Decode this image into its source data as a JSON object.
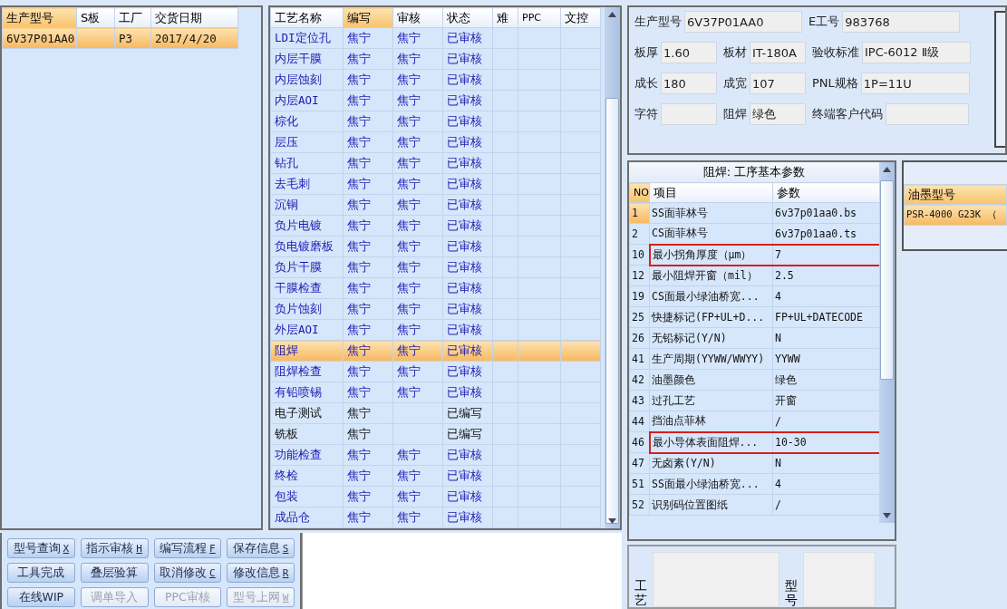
{
  "orders": {
    "columns": [
      {
        "label": "生产型号",
        "sorted": true
      },
      {
        "label": "S板",
        "sorted": false
      },
      {
        "label": "工厂",
        "sorted": false
      },
      {
        "label": "交货日期",
        "sorted": false
      }
    ],
    "rows": [
      {
        "cells": [
          "6V37P01AA0",
          "",
          "P3",
          "2017/4/20"
        ],
        "selected": true
      }
    ]
  },
  "process": {
    "columns": [
      {
        "label": "工艺名称",
        "sorted": false
      },
      {
        "label": "编写",
        "sorted": true
      },
      {
        "label": "审核",
        "sorted": false
      },
      {
        "label": "状态",
        "sorted": false
      },
      {
        "label": "难",
        "sorted": false
      },
      {
        "label": "PPC",
        "sorted": false
      },
      {
        "label": "文控",
        "sorted": false
      }
    ],
    "rows": [
      {
        "cells": [
          "LDI定位孔",
          "焦宁",
          "焦宁",
          "已审核",
          "",
          "",
          ""
        ],
        "reviewed": true,
        "selected": false
      },
      {
        "cells": [
          "内层干膜",
          "焦宁",
          "焦宁",
          "已审核",
          "",
          "",
          ""
        ],
        "reviewed": true,
        "selected": false
      },
      {
        "cells": [
          "内层蚀刻",
          "焦宁",
          "焦宁",
          "已审核",
          "",
          "",
          ""
        ],
        "reviewed": true,
        "selected": false
      },
      {
        "cells": [
          "内层AOI",
          "焦宁",
          "焦宁",
          "已审核",
          "",
          "",
          ""
        ],
        "reviewed": true,
        "selected": false
      },
      {
        "cells": [
          "棕化",
          "焦宁",
          "焦宁",
          "已审核",
          "",
          "",
          ""
        ],
        "reviewed": true,
        "selected": false
      },
      {
        "cells": [
          "层压",
          "焦宁",
          "焦宁",
          "已审核",
          "",
          "",
          ""
        ],
        "reviewed": true,
        "selected": false
      },
      {
        "cells": [
          "钻孔",
          "焦宁",
          "焦宁",
          "已审核",
          "",
          "",
          ""
        ],
        "reviewed": true,
        "selected": false
      },
      {
        "cells": [
          "去毛刺",
          "焦宁",
          "焦宁",
          "已审核",
          "",
          "",
          ""
        ],
        "reviewed": true,
        "selected": false
      },
      {
        "cells": [
          "沉铜",
          "焦宁",
          "焦宁",
          "已审核",
          "",
          "",
          ""
        ],
        "reviewed": true,
        "selected": false
      },
      {
        "cells": [
          "负片电镀",
          "焦宁",
          "焦宁",
          "已审核",
          "",
          "",
          ""
        ],
        "reviewed": true,
        "selected": false
      },
      {
        "cells": [
          "负电镀磨板",
          "焦宁",
          "焦宁",
          "已审核",
          "",
          "",
          ""
        ],
        "reviewed": true,
        "selected": false
      },
      {
        "cells": [
          "负片干膜",
          "焦宁",
          "焦宁",
          "已审核",
          "",
          "",
          ""
        ],
        "reviewed": true,
        "selected": false
      },
      {
        "cells": [
          "干膜检查",
          "焦宁",
          "焦宁",
          "已审核",
          "",
          "",
          ""
        ],
        "reviewed": true,
        "selected": false
      },
      {
        "cells": [
          "负片蚀刻",
          "焦宁",
          "焦宁",
          "已审核",
          "",
          "",
          ""
        ],
        "reviewed": true,
        "selected": false
      },
      {
        "cells": [
          "外层AOI",
          "焦宁",
          "焦宁",
          "已审核",
          "",
          "",
          ""
        ],
        "reviewed": true,
        "selected": false
      },
      {
        "cells": [
          "阻焊",
          "焦宁",
          "焦宁",
          "已审核",
          "",
          "",
          ""
        ],
        "reviewed": true,
        "selected": true
      },
      {
        "cells": [
          "阻焊检查",
          "焦宁",
          "焦宁",
          "已审核",
          "",
          "",
          ""
        ],
        "reviewed": true,
        "selected": false
      },
      {
        "cells": [
          "有铅喷锡",
          "焦宁",
          "焦宁",
          "已审核",
          "",
          "",
          ""
        ],
        "reviewed": true,
        "selected": false
      },
      {
        "cells": [
          "电子测试",
          "焦宁",
          "",
          "已编写",
          "",
          "",
          ""
        ],
        "reviewed": false,
        "selected": false
      },
      {
        "cells": [
          "铣板",
          "焦宁",
          "",
          "已编写",
          "",
          "",
          ""
        ],
        "reviewed": false,
        "selected": false
      },
      {
        "cells": [
          "功能检查",
          "焦宁",
          "焦宁",
          "已审核",
          "",
          "",
          ""
        ],
        "reviewed": true,
        "selected": false
      },
      {
        "cells": [
          "终检",
          "焦宁",
          "焦宁",
          "已审核",
          "",
          "",
          ""
        ],
        "reviewed": true,
        "selected": false
      },
      {
        "cells": [
          "包装",
          "焦宁",
          "焦宁",
          "已审核",
          "",
          "",
          ""
        ],
        "reviewed": true,
        "selected": false
      },
      {
        "cells": [
          "成品仓",
          "焦宁",
          "焦宁",
          "已审核",
          "",
          "",
          ""
        ],
        "reviewed": true,
        "selected": false
      }
    ]
  },
  "buttons": [
    {
      "label": "型号查询",
      "key": "X",
      "disabled": false
    },
    {
      "label": "指示审核",
      "key": "H",
      "disabled": false
    },
    {
      "label": "编写流程",
      "key": "F",
      "disabled": false
    },
    {
      "label": "保存信息",
      "key": "S",
      "disabled": false
    },
    {
      "label": "工具完成",
      "disabled": false
    },
    {
      "label": "叠层验算",
      "disabled": false
    },
    {
      "label": "取消修改",
      "key": "C",
      "disabled": false
    },
    {
      "label": "修改信息",
      "key": "R",
      "disabled": false
    },
    {
      "label": "在线WIP",
      "disabled": false
    },
    {
      "label": "调单导入",
      "disabled": true
    },
    {
      "label": "PPC审核",
      "disabled": true
    },
    {
      "label": "型号上网",
      "key": "W",
      "disabled": true
    }
  ],
  "info_fields": [
    [
      {
        "label": "生产型号",
        "value": "6V37P01AA0"
      },
      {
        "label": "E工号",
        "value": "983768"
      }
    ],
    [
      {
        "label": "板厚",
        "value": "1.60"
      },
      {
        "label": "板材",
        "value": "IT-180A"
      },
      {
        "label": "验收标准",
        "value": "IPC-6012 Ⅱ级"
      }
    ],
    [
      {
        "label": "成长",
        "value": "180"
      },
      {
        "label": "成宽",
        "value": "107"
      },
      {
        "label": "PNL规格",
        "value": "1P=11U"
      }
    ],
    [
      {
        "label": "字符"
      },
      {
        "label": "阻焊",
        "value": "绿色"
      },
      {
        "label": "终端客户代码"
      }
    ]
  ],
  "params": {
    "title": "阻焊: 工序基本参数",
    "columns": [
      {
        "label": "NO",
        "sorted": true
      },
      {
        "label": "项目",
        "sorted": false
      },
      {
        "label": "参数",
        "sorted": false
      }
    ],
    "rows": [
      {
        "no": "1",
        "item": "SS面菲林号",
        "value": "6v37p01aa0.bs",
        "selected": true,
        "flagged": false
      },
      {
        "no": "2",
        "item": "CS面菲林号",
        "value": "6v37p01aa0.ts",
        "selected": false,
        "flagged": false
      },
      {
        "no": "10",
        "item": "最小拐角厚度（μm）",
        "value": "7",
        "selected": false,
        "flagged": true
      },
      {
        "no": "12",
        "item": "最小阻焊开窗（mil）",
        "value": "2.5",
        "selected": false,
        "flagged": false
      },
      {
        "no": "19",
        "item": "CS面最小绿油桥宽...",
        "value": "4",
        "selected": false,
        "flagged": false
      },
      {
        "no": "25",
        "item": "快捷标记(FP+UL+D...",
        "value": "FP+UL+DATECODE",
        "selected": false,
        "flagged": false
      },
      {
        "no": "26",
        "item": "无铅标记(Y/N)",
        "value": "N",
        "selected": false,
        "flagged": false
      },
      {
        "no": "41",
        "item": "生产周期(YYWW/WWYY)",
        "value": "YYWW",
        "selected": false,
        "flagged": false
      },
      {
        "no": "42",
        "item": "油墨颜色",
        "value": "绿色",
        "selected": false,
        "flagged": false
      },
      {
        "no": "43",
        "item": "过孔工艺",
        "value": "开窗",
        "selected": false,
        "flagged": false
      },
      {
        "no": "44",
        "item": "挡油点菲林",
        "value": "/",
        "selected": false,
        "flagged": false
      },
      {
        "no": "46",
        "item": "最小导体表面阻焊...",
        "value": "10-30",
        "selected": false,
        "flagged": true
      },
      {
        "no": "47",
        "item": "无卤素(Y/N)",
        "value": "N",
        "selected": false,
        "flagged": false
      },
      {
        "no": "51",
        "item": "SS面最小绿油桥宽...",
        "value": "4",
        "selected": false,
        "flagged": false
      },
      {
        "no": "52",
        "item": "识别码位置图纸",
        "value": "/",
        "selected": false,
        "flagged": false
      }
    ]
  },
  "ink": {
    "column": "油墨型号",
    "rows": [
      {
        "value": "PSR-4000 G23K （",
        "selected": true
      }
    ]
  },
  "notes": [
    {
      "label": "工艺"
    },
    {
      "label": "型号"
    }
  ]
}
